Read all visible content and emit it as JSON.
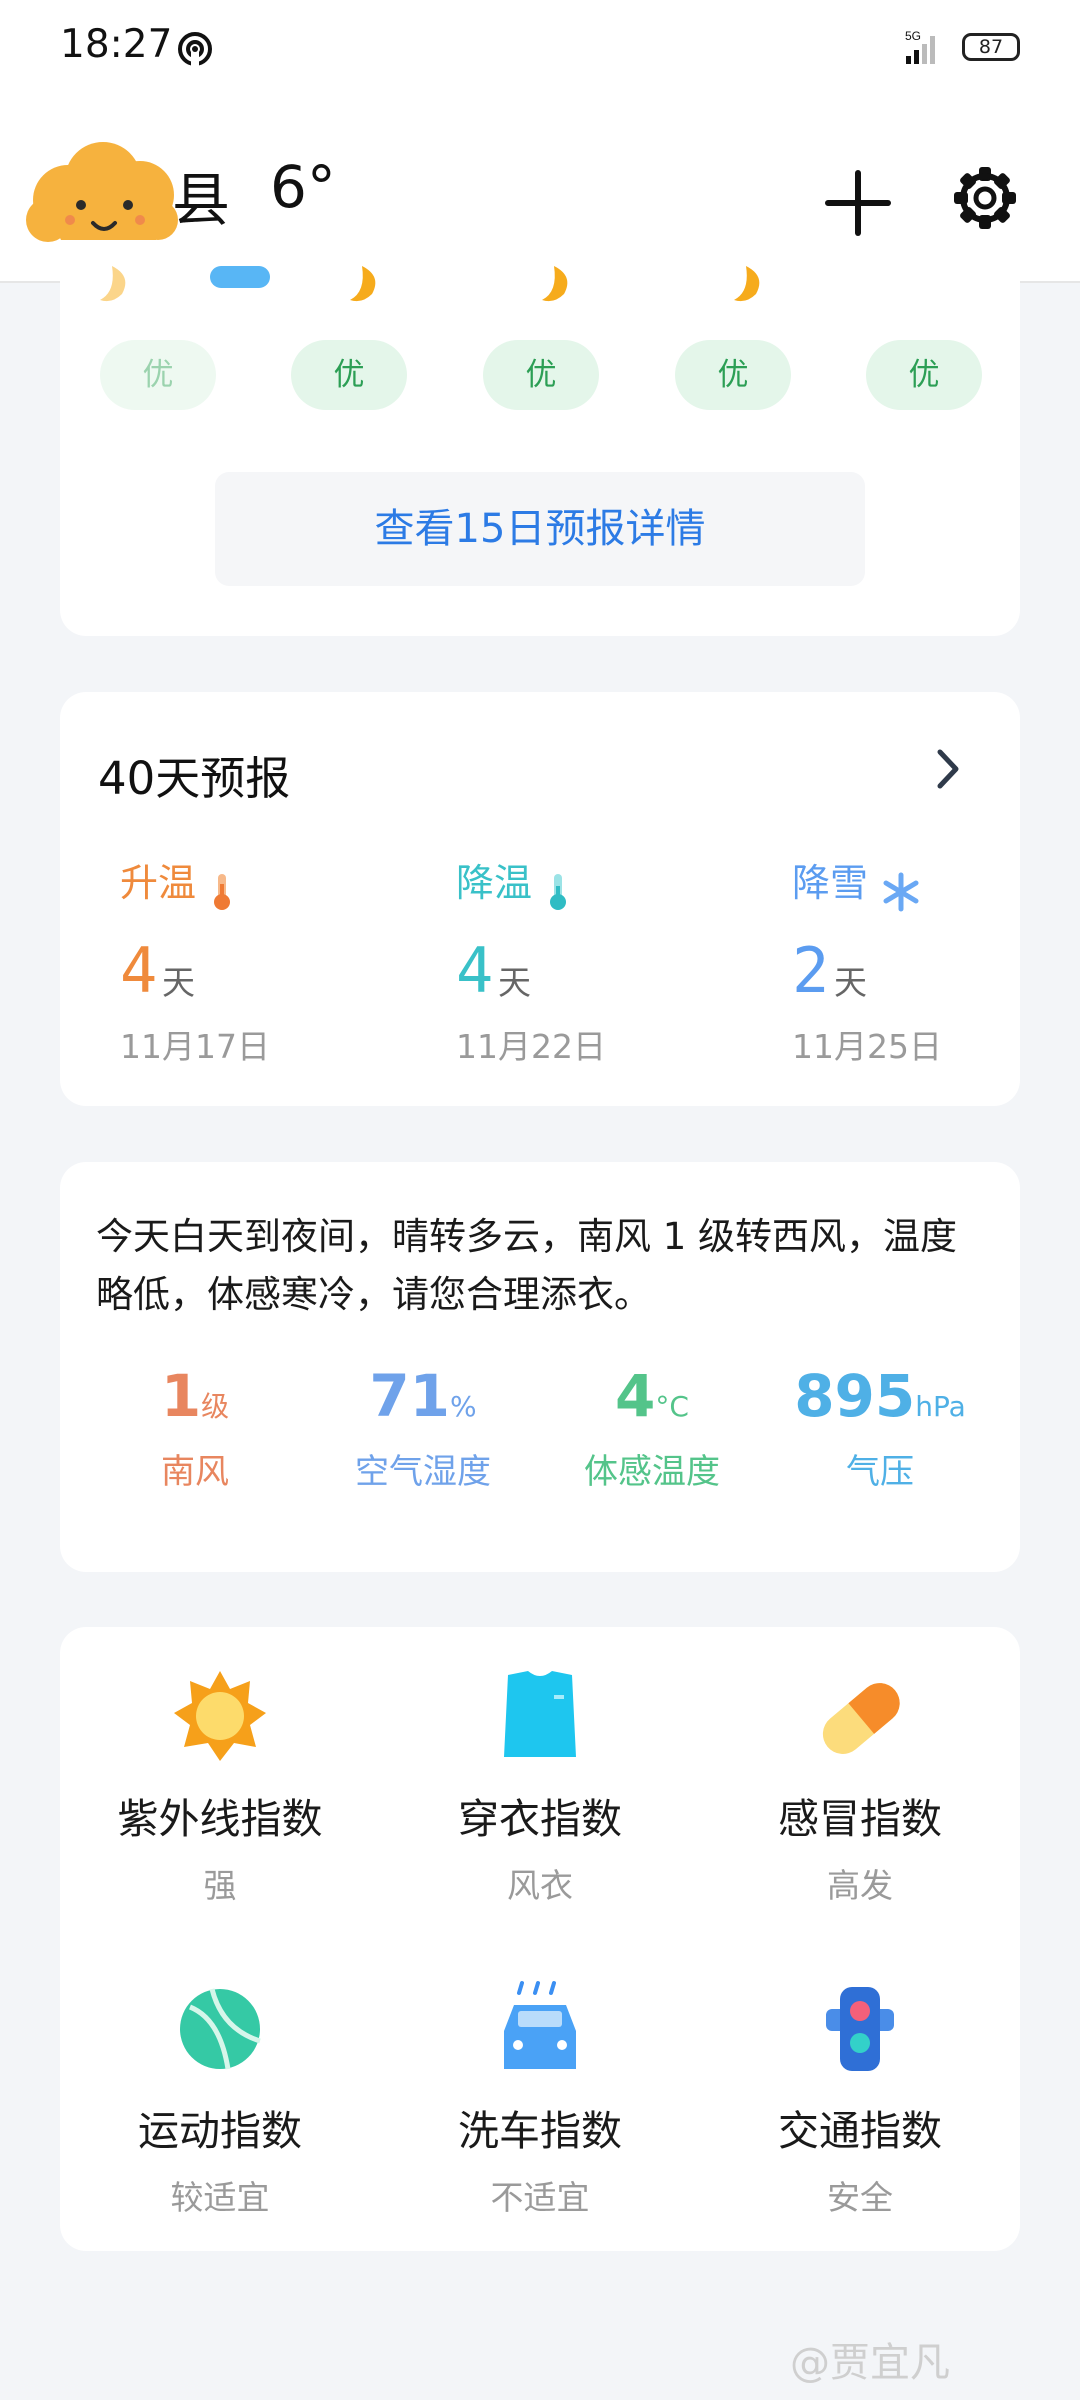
{
  "status_bar": {
    "time": "18:27",
    "network": "5G",
    "battery": "87"
  },
  "header": {
    "city": "县",
    "temperature": "6°"
  },
  "forecast_15": {
    "aqi_labels": [
      "优",
      "优",
      "优",
      "优",
      "优"
    ],
    "detail_button": "查看15日预报详情"
  },
  "forecast_40": {
    "title": "40天预报",
    "trends": [
      {
        "label": "升温",
        "count": "4",
        "unit": "天",
        "date": "11月17日",
        "color": "#ef8a3c",
        "icon": "thermometer-warm-icon"
      },
      {
        "label": "降温",
        "count": "4",
        "unit": "天",
        "date": "11月22日",
        "color": "#39c1c8",
        "icon": "thermometer-cool-icon"
      },
      {
        "label": "降雪",
        "count": "2",
        "unit": "天",
        "date": "11月25日",
        "color": "#5b9cf0",
        "icon": "snowflake-icon"
      }
    ]
  },
  "summary": {
    "text": "今天白天到夜间，晴转多云，南风 1 级转西风，温度略低，体感寒冷，请您合理添衣。",
    "stats": [
      {
        "value": "1",
        "unit": "级",
        "label": "南风",
        "color": "#e8865f"
      },
      {
        "value": "71",
        "unit": "%",
        "label": "空气湿度",
        "color": "#6fa2ea"
      },
      {
        "value": "4",
        "unit": "°C",
        "label": "体感温度",
        "color": "#54c48a"
      },
      {
        "value": "895",
        "unit": "hPa",
        "label": "气压",
        "color": "#4fb0e6"
      }
    ]
  },
  "indices": [
    {
      "name": "紫外线指数",
      "value": "强",
      "icon": "sun-icon"
    },
    {
      "name": "穿衣指数",
      "value": "风衣",
      "icon": "shirt-icon"
    },
    {
      "name": "感冒指数",
      "value": "高发",
      "icon": "pill-icon"
    },
    {
      "name": "运动指数",
      "value": "较适宜",
      "icon": "ball-icon"
    },
    {
      "name": "洗车指数",
      "value": "不适宜",
      "icon": "car-icon"
    },
    {
      "name": "交通指数",
      "value": "安全",
      "icon": "traffic-light-icon"
    }
  ],
  "watermark": "@贾宜凡"
}
